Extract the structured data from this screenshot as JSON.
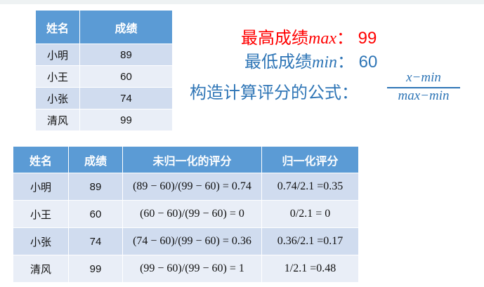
{
  "table1": {
    "headers": [
      "姓名",
      "成绩"
    ],
    "rows": [
      [
        "小明",
        "89"
      ],
      [
        "小王",
        "60"
      ],
      [
        "小张",
        "74"
      ],
      [
        "清风",
        "99"
      ]
    ]
  },
  "info": {
    "max_label": "最高成绩",
    "max_var": "max",
    "max_sep": "：",
    "max_value": "99",
    "min_label": "最低成绩",
    "min_var": "min",
    "min_sep": "：",
    "min_value": "60",
    "formula_label": "构造计算评分的公式：",
    "formula_numerator": "x−min",
    "formula_denominator": "max−min"
  },
  "colors": {
    "header": "#5b9bd5",
    "row_odd": "#d0dcef",
    "row_even": "#e9eef7",
    "max_text": "#ff0000",
    "min_text": "#2e75b6"
  },
  "table2": {
    "headers": [
      "姓名",
      "成绩",
      "未归一化的评分",
      "归一化评分"
    ],
    "rows": [
      [
        "小明",
        "89",
        "(89 − 60)/(99 − 60) = 0.74",
        "0.74/2.1 =0.35"
      ],
      [
        "小王",
        "60",
        "(60 − 60)/(99 − 60) = 0",
        "0/2.1 = 0"
      ],
      [
        "小张",
        "74",
        "(74 − 60)/(99 − 60) = 0.36",
        "0.36/2.1 =0.17"
      ],
      [
        "清风",
        "99",
        "(99 − 60)/(99 − 60) = 1",
        "1/2.1 =0.48"
      ]
    ]
  }
}
